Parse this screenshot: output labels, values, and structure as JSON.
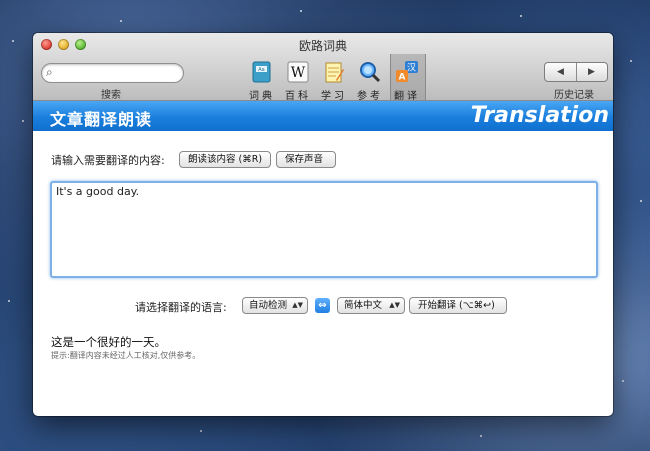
{
  "window": {
    "title": "欧路词典"
  },
  "toolbar": {
    "search": {
      "placeholder": "",
      "value": "",
      "label": "搜索"
    },
    "tools": [
      {
        "label": "词典",
        "icon": "dictionary-book-icon"
      },
      {
        "label": "百科",
        "icon": "wikipedia-w-icon"
      },
      {
        "label": "学习",
        "icon": "study-notepad-icon"
      },
      {
        "label": "参考",
        "icon": "reference-magnifier-icon"
      },
      {
        "label": "翻译",
        "icon": "translate-icon",
        "active": true
      }
    ],
    "history": {
      "label": "历史记录",
      "back": "◀",
      "forward": "▶"
    }
  },
  "banner": {
    "title": "文章翻译朗读",
    "subtitle": "Translation",
    "color": "#1a7fdc"
  },
  "translate": {
    "prompt": "请输入需要翻译的内容:",
    "read_button": "朗读该内容 (⌘R)",
    "save_button": "保存声音",
    "input_text": "It's a good day.",
    "language_label": "请选择翻译的语言:",
    "source_language": "自动检测",
    "swap_symbol": "⇔",
    "target_language": "简体中文",
    "translate_button": "开始翻译 (⌥⌘↩)",
    "result_text": "这是一个很好的一天。",
    "hint": "提示:翻译内容未经过人工核对,仅供参考。"
  }
}
